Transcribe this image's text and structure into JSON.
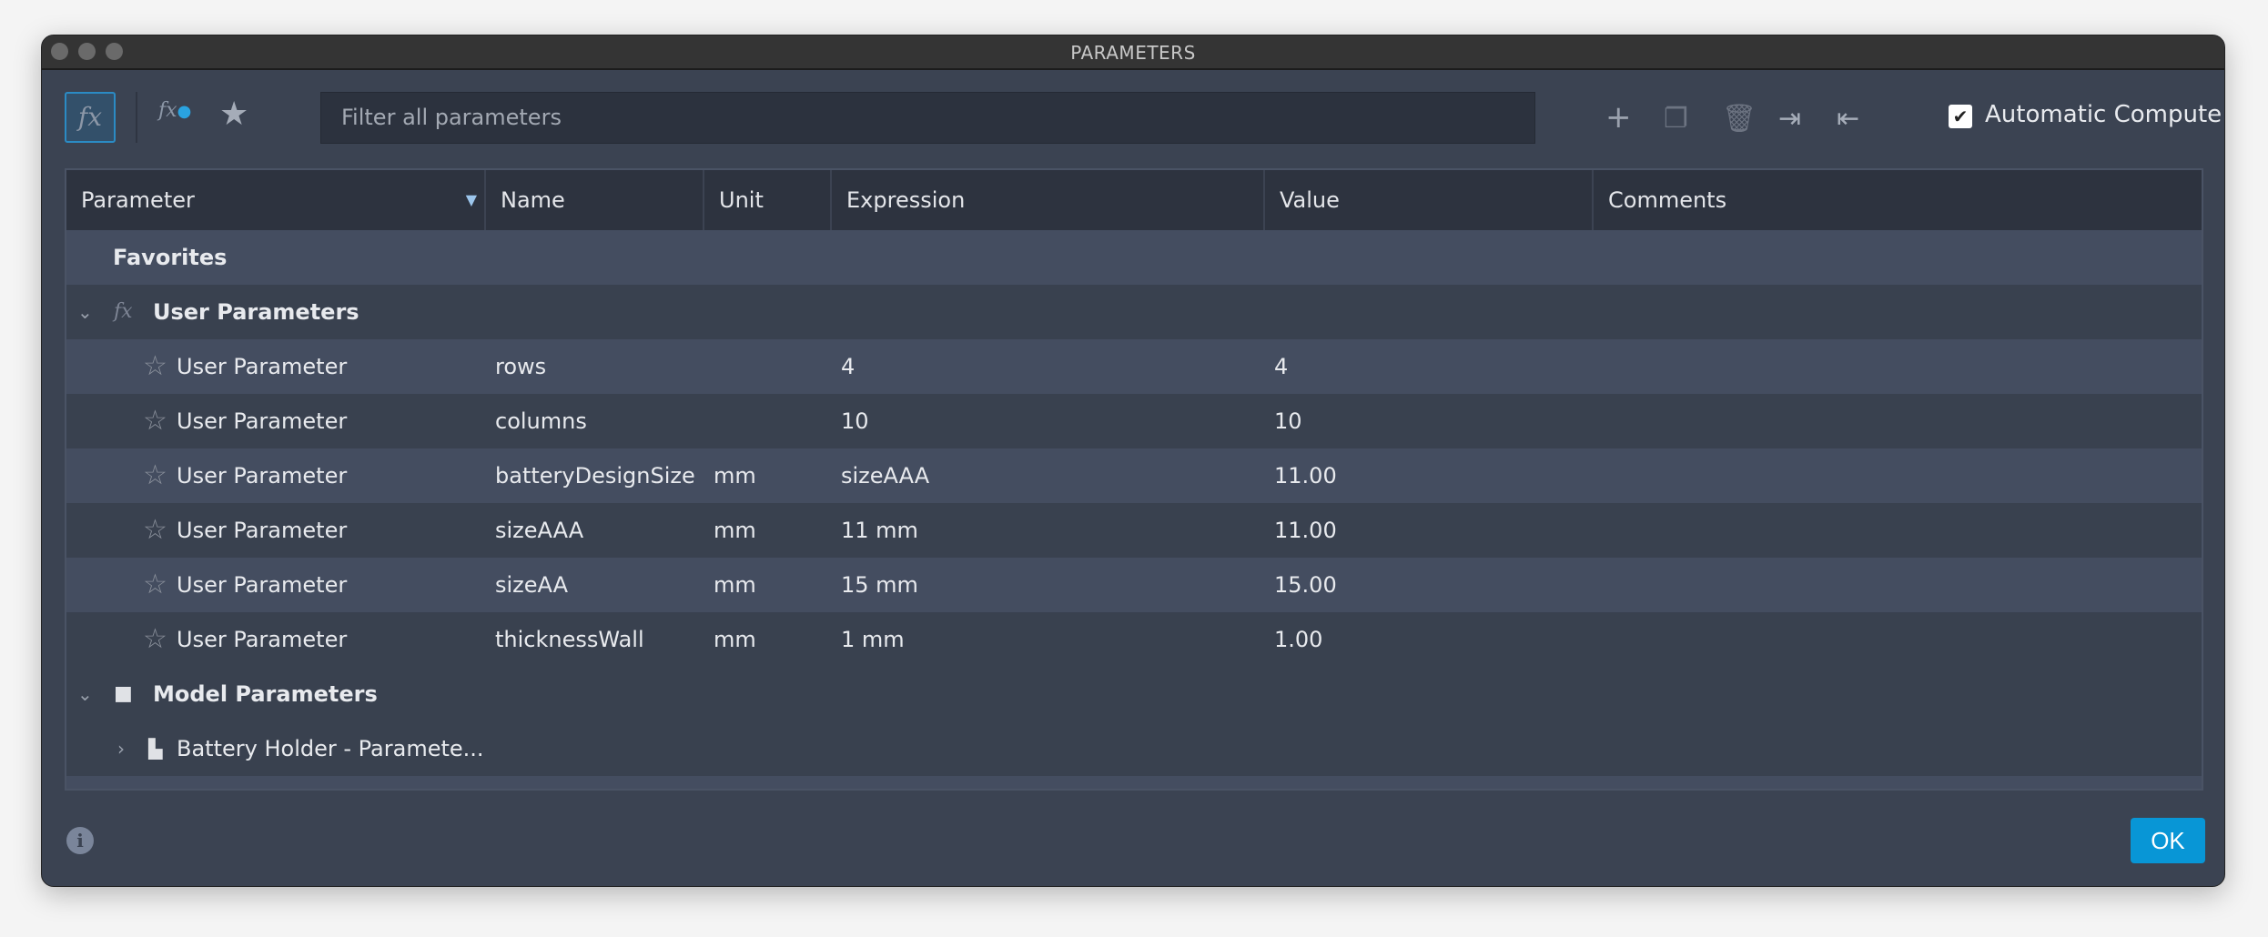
{
  "window": {
    "title": "PARAMETERS"
  },
  "toolbar": {
    "filter_placeholder": "Filter all parameters",
    "automatic_compute_label": "Automatic Compute",
    "automatic_compute_checked": true,
    "fx_label": "fx",
    "fx_user_label": "fx"
  },
  "table": {
    "columns": [
      "Parameter",
      "Name",
      "Unit",
      "Expression",
      "Value",
      "Comments"
    ],
    "favorites_label": "Favorites",
    "user_group_label": "User Parameters",
    "user_rows": [
      {
        "parameter": "User Parameter",
        "name": "rows",
        "unit": "",
        "expression": "4",
        "value": "4",
        "comments": ""
      },
      {
        "parameter": "User Parameter",
        "name": "columns",
        "unit": "",
        "expression": "10",
        "value": "10",
        "comments": ""
      },
      {
        "parameter": "User Parameter",
        "name": "batteryDesignSize",
        "unit": "mm",
        "expression": "sizeAAA",
        "value": "11.00",
        "comments": ""
      },
      {
        "parameter": "User Parameter",
        "name": "sizeAAA",
        "unit": "mm",
        "expression": "11 mm",
        "value": "11.00",
        "comments": ""
      },
      {
        "parameter": "User Parameter",
        "name": "sizeAA",
        "unit": "mm",
        "expression": "15 mm",
        "value": "15.00",
        "comments": ""
      },
      {
        "parameter": "User Parameter",
        "name": "thicknessWall",
        "unit": "mm",
        "expression": "1 mm",
        "value": "1.00",
        "comments": ""
      }
    ],
    "model_group_label": "Model Parameters",
    "model_child_label": "Battery Holder - Paramete..."
  },
  "footer": {
    "ok_label": "OK",
    "info_glyph": "i"
  },
  "colors": {
    "accent": "#0896d6",
    "window_bg": "#3b4352",
    "header_bg": "#2d333f"
  }
}
